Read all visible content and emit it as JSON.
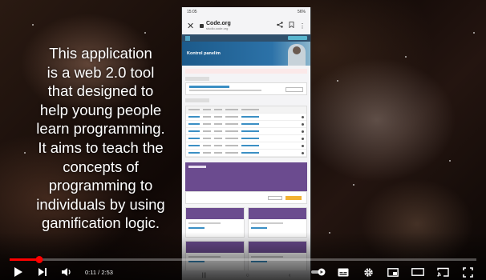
{
  "overlay": {
    "lines": [
      "This application",
      "is a web 2.0 tool",
      "that designed to",
      "help young people",
      "learn programming.",
      "It aims to teach the",
      "concepts of",
      "programming to",
      "individuals by using",
      "gamification logic."
    ]
  },
  "phone": {
    "status_time": "15:05",
    "status_right": "56%",
    "url_main": "Code.org",
    "url_sub": "studio.code.org",
    "hero_title": "Kontrol panelim"
  },
  "player": {
    "time_current": "0:11",
    "time_separator": " / ",
    "time_total": "2:53",
    "progress": 0.064,
    "icons": {
      "play": "play-icon",
      "next": "next-icon",
      "volume": "volume-icon",
      "autoplay": "autoplay-toggle-icon",
      "subtitles": "subtitles-icon",
      "settings": "gear-icon",
      "miniplayer": "miniplayer-icon",
      "theater": "theater-mode-icon",
      "cast": "cast-icon",
      "fullscreen": "fullscreen-icon"
    },
    "colors": {
      "progress": "#ff0000"
    }
  }
}
